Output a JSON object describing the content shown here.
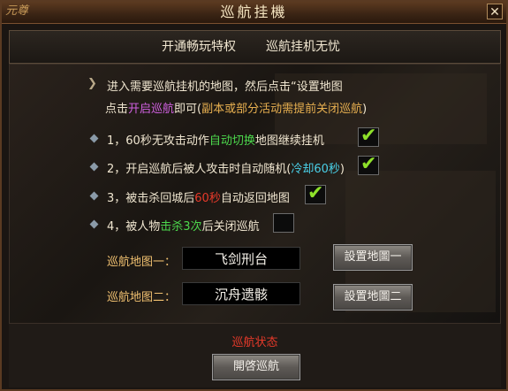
{
  "window": {
    "title": "巡航挂機",
    "logo_text": "元尊"
  },
  "topbar": {
    "item1": "开通畅玩特权",
    "item2": "巡航挂机无忧"
  },
  "instructions": {
    "line1": "进入需要巡航挂机的地图，然后点击“设置地图",
    "line2_a": "点击",
    "line2_b": "开启巡航",
    "line2_c": "即可(",
    "line2_d": "副本或部分活动需提前关闭巡航",
    "line2_e": ")"
  },
  "options": [
    {
      "a": "1，60秒无攻击动作",
      "b": "自动切换",
      "c": "地图继续挂机",
      "checked": true
    },
    {
      "a": "2，开启巡航后被人攻击时自动随机(",
      "b": "冷却60秒",
      "c": ")",
      "checked": true
    },
    {
      "a": "3，被击杀回城后",
      "b": "60秒",
      "c": "自动返回地图",
      "checked": true
    },
    {
      "a": "4，被人物",
      "b": "击杀3次",
      "c": "后关闭巡航",
      "checked": false
    }
  ],
  "maps": {
    "map1_label": "巡航地图一：",
    "map1_value": "飞剑刑台",
    "map1_button": "設置地圖一",
    "map2_label": "巡航地图二：",
    "map2_value": "沉舟遗骸",
    "map2_button": "設置地圖二"
  },
  "footer": {
    "status": "巡航状态",
    "start_button": "開啓巡航"
  },
  "colors": {
    "highlight_green": "#4cd84c",
    "highlight_cyan": "#4ad0e8",
    "highlight_red": "#e83a2a",
    "highlight_purple": "#d060e0",
    "highlight_orange": "#e8b050"
  },
  "icons": {
    "instruction": "arrow-icon",
    "option": "diamond-icon",
    "check": "check-icon",
    "close": "close-icon"
  }
}
